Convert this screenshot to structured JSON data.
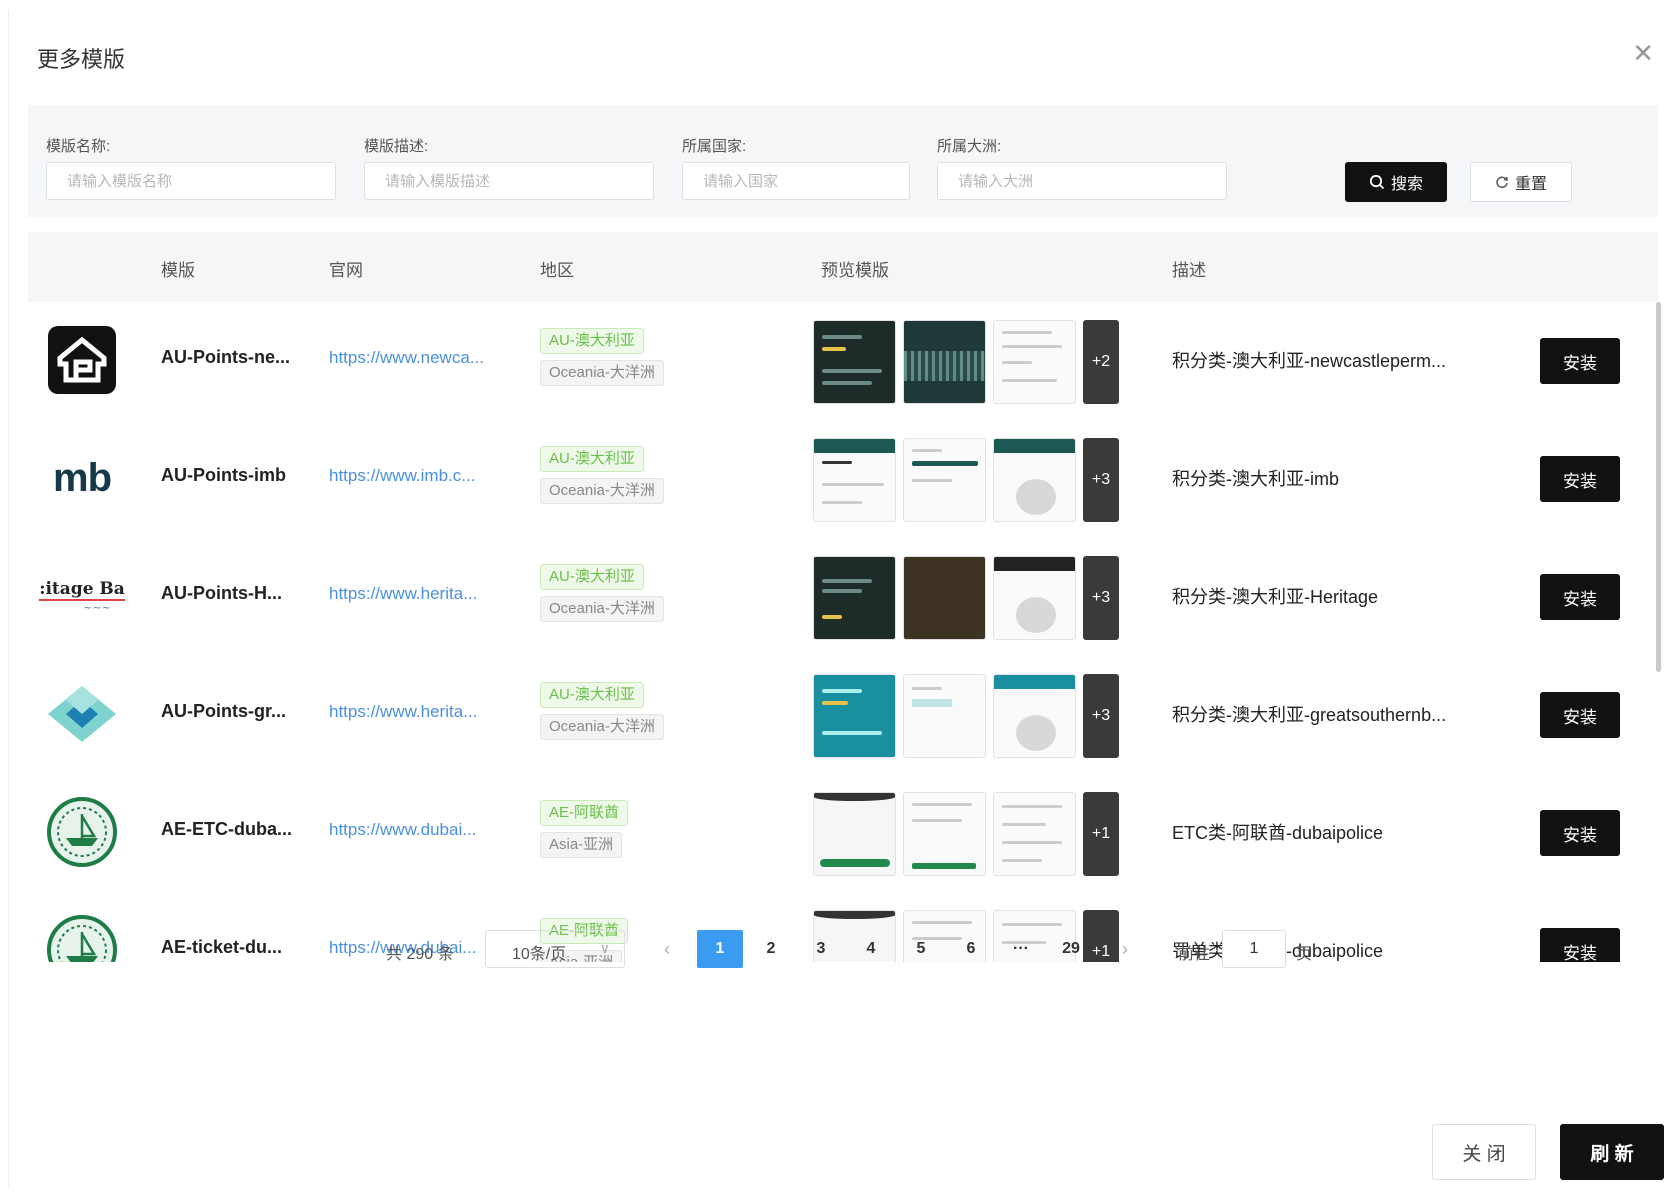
{
  "dialog": {
    "title": "更多模版",
    "close_icon": "close-icon"
  },
  "filters": {
    "template_name": {
      "label": "模版名称:",
      "placeholder": "请输入模版名称",
      "value": ""
    },
    "template_desc": {
      "label": "模版描述:",
      "placeholder": "请输入模版描述",
      "value": ""
    },
    "country": {
      "label": "所属国家:",
      "placeholder": "请输入国家",
      "value": ""
    },
    "continent": {
      "label": "所属大洲:",
      "placeholder": "请输入大洲",
      "value": ""
    },
    "search_label": "搜索",
    "reset_label": "重置"
  },
  "table": {
    "columns": [
      "模版",
      "官网",
      "地区",
      "预览模版",
      "描述"
    ],
    "install_label": "安装",
    "rows": [
      {
        "name": "AU-Points-ne...",
        "url": "https://www.newca...",
        "country_tag": "AU-澳大利亚",
        "continent_tag": "Oceania-大洋洲",
        "more": "+2",
        "desc": "积分类-澳大利亚-newcastleperm...",
        "logo": "house-logo"
      },
      {
        "name": "AU-Points-imb",
        "url": "https://www.imb.c...",
        "country_tag": "AU-澳大利亚",
        "continent_tag": "Oceania-大洋洲",
        "more": "+3",
        "desc": "积分类-澳大利亚-imb",
        "logo": "mb-logo",
        "logo_text": "mb"
      },
      {
        "name": "AU-Points-H...",
        "url": "https://www.herita...",
        "country_tag": "AU-澳大利亚",
        "continent_tag": "Oceania-大洋洲",
        "more": "+3",
        "desc": "积分类-澳大利亚-Heritage",
        "logo": "heritage-logo",
        "logo_text": ":itage Ba"
      },
      {
        "name": "AU-Points-gr...",
        "url": "https://www.herita...",
        "country_tag": "AU-澳大利亚",
        "continent_tag": "Oceania-大洋洲",
        "more": "+3",
        "desc": "积分类-澳大利亚-greatsouthernb...",
        "logo": "diamond-logo"
      },
      {
        "name": "AE-ETC-duba...",
        "url": "https://www.dubai...",
        "country_tag": "AE-阿联酋",
        "continent_tag": "Asia-亚洲",
        "more": "+1",
        "desc": "ETC类-阿联酋-dubaipolice",
        "logo": "dubai-police-logo"
      },
      {
        "name": "AE-ticket-du...",
        "url": "https://www.dubai...",
        "country_tag": "AE-阿联酋",
        "continent_tag": "Asia-亚洲",
        "more": "+1",
        "desc": "罚单类-阿联酋-dubaipolice",
        "logo": "dubai-police-logo"
      }
    ]
  },
  "pagination": {
    "total": "共 290 条",
    "page_size": "10条/页",
    "pages": [
      "1",
      "2",
      "3",
      "4",
      "5",
      "6",
      "···",
      "29"
    ],
    "current": "1",
    "goto_label": "前往",
    "goto_value": "1",
    "page_unit": "页"
  },
  "footer": {
    "close_label": "关 闭",
    "refresh_label": "刷 新"
  },
  "colors": {
    "primary_black": "#111111",
    "active_page": "#3a9bf0",
    "link": "#4a90e2",
    "tag_green": "#6cc04a"
  }
}
